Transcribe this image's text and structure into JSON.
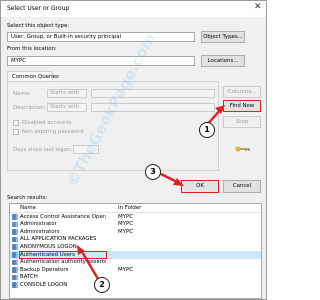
{
  "window": {
    "title": "Select User or Group",
    "close_glyph": "✕"
  },
  "object_type": {
    "label": "Select this object type:",
    "value": "User, Group, or Built-in security principal",
    "button": "Object Types..."
  },
  "location": {
    "label": "From this location:",
    "value": "MYPC",
    "button": "Locations..."
  },
  "common_queries": {
    "tab": "Common Queries",
    "name_label": "Name:",
    "name_op": "Starts with",
    "description_label": "Description:",
    "description_op": "Starts with",
    "disabled_accounts": "Disabled accounts",
    "non_expiring_password": "Non expiring password",
    "days_since_logon": "Days since last logon:"
  },
  "buttons": {
    "columns": "Columns...",
    "find_now": "Find Now",
    "stop": "Stop",
    "ok": "OK",
    "cancel": "Cancel"
  },
  "results": {
    "label": "Search results:",
    "columns": [
      "Name",
      "In Folder"
    ],
    "rows": [
      {
        "name": "Access Control Assistance Operat...",
        "folder": "MYPC",
        "icon": "group-icon"
      },
      {
        "name": "Administrator",
        "folder": "MYPC",
        "icon": "user-icon"
      },
      {
        "name": "Administrators",
        "folder": "MYPC",
        "icon": "group-icon"
      },
      {
        "name": "ALL APPLICATION PACKAGES",
        "folder": "",
        "icon": "group-icon"
      },
      {
        "name": "ANONYMOUS LOGON",
        "folder": "",
        "icon": "group-icon"
      },
      {
        "name": "Authenticated Users",
        "folder": "",
        "icon": "group-icon",
        "selected": true
      },
      {
        "name": "Authentication authority asserted...",
        "folder": "",
        "icon": "group-icon"
      },
      {
        "name": "Backup Operators",
        "folder": "MYPC",
        "icon": "group-icon"
      },
      {
        "name": "BATCH",
        "folder": "",
        "icon": "group-icon"
      },
      {
        "name": "CONSOLE LOGON",
        "folder": "",
        "icon": "group-icon"
      }
    ]
  },
  "annotations": {
    "step1": "1",
    "step2": "2",
    "step3": "3",
    "color": "#e02020"
  },
  "watermark": "©TheGeekPage.com"
}
